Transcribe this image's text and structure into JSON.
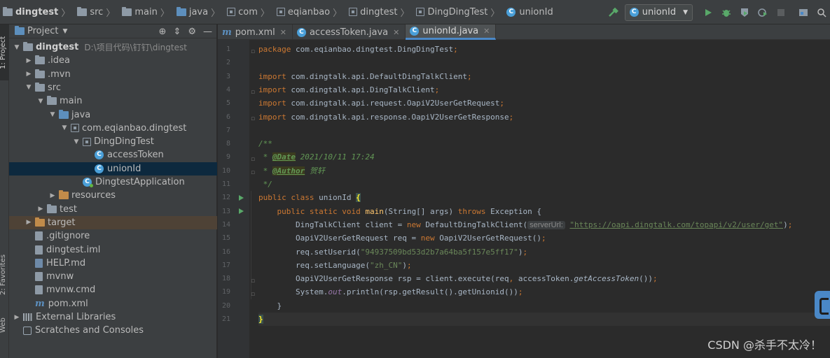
{
  "breadcrumbs": [
    {
      "label": "dingtest",
      "icon": "project-folder-icon",
      "bold": true
    },
    {
      "label": "src",
      "icon": "folder-icon"
    },
    {
      "label": "main",
      "icon": "folder-icon"
    },
    {
      "label": "java",
      "icon": "source-folder-icon"
    },
    {
      "label": "com",
      "icon": "package-icon"
    },
    {
      "label": "eqianbao",
      "icon": "package-icon"
    },
    {
      "label": "dingtest",
      "icon": "package-icon"
    },
    {
      "label": "DingDingTest",
      "icon": "package-icon"
    },
    {
      "label": "unionId",
      "icon": "class-icon"
    }
  ],
  "toolbar": {
    "run_config": "unionId",
    "icons": [
      "build-hammer-icon",
      "run-icon",
      "debug-icon",
      "coverage-icon",
      "profile-icon",
      "stop-icon",
      "project-structure-icon",
      "search-icon"
    ]
  },
  "left_stripe": {
    "tabs": [
      "1: Project",
      "2: Favorites",
      "Web"
    ]
  },
  "project_panel": {
    "title": "Project",
    "tree": [
      {
        "label": "dingtest",
        "path": "D:\\项目代码\\钉钉\\dingtest",
        "depth": 0,
        "arrow": "open",
        "icon": "project-folder-icon",
        "bold": true
      },
      {
        "label": ".idea",
        "depth": 1,
        "arrow": "closed",
        "icon": "folder-icon"
      },
      {
        "label": ".mvn",
        "depth": 1,
        "arrow": "closed",
        "icon": "folder-icon"
      },
      {
        "label": "src",
        "depth": 1,
        "arrow": "open",
        "icon": "folder-icon"
      },
      {
        "label": "main",
        "depth": 2,
        "arrow": "open",
        "icon": "folder-icon"
      },
      {
        "label": "java",
        "depth": 3,
        "arrow": "open",
        "icon": "source-folder-icon"
      },
      {
        "label": "com.eqianbao.dingtest",
        "depth": 4,
        "arrow": "open",
        "icon": "package-icon"
      },
      {
        "label": "DingDingTest",
        "depth": 5,
        "arrow": "open",
        "icon": "package-icon"
      },
      {
        "label": "accessToken",
        "depth": 6,
        "arrow": "none",
        "icon": "class-icon"
      },
      {
        "label": "unionId",
        "depth": 6,
        "arrow": "none",
        "icon": "class-icon",
        "selected": true
      },
      {
        "label": "DingtestApplication",
        "depth": 5,
        "arrow": "none",
        "icon": "spring-class-icon"
      },
      {
        "label": "resources",
        "depth": 3,
        "arrow": "closed",
        "icon": "resources-folder-icon"
      },
      {
        "label": "test",
        "depth": 2,
        "arrow": "closed",
        "icon": "folder-icon"
      },
      {
        "label": "target",
        "depth": 1,
        "arrow": "closed",
        "icon": "excluded-folder-icon",
        "excluded": true
      },
      {
        "label": ".gitignore",
        "depth": 1,
        "arrow": "none",
        "icon": "file-icon"
      },
      {
        "label": "dingtest.iml",
        "depth": 1,
        "arrow": "none",
        "icon": "iml-file-icon"
      },
      {
        "label": "HELP.md",
        "depth": 1,
        "arrow": "none",
        "icon": "markdown-file-icon"
      },
      {
        "label": "mvnw",
        "depth": 1,
        "arrow": "none",
        "icon": "file-icon"
      },
      {
        "label": "mvnw.cmd",
        "depth": 1,
        "arrow": "none",
        "icon": "file-icon"
      },
      {
        "label": "pom.xml",
        "depth": 1,
        "arrow": "none",
        "icon": "maven-icon"
      },
      {
        "label": "External Libraries",
        "depth": 0,
        "arrow": "closed",
        "icon": "libraries-icon"
      },
      {
        "label": "Scratches and Consoles",
        "depth": 0,
        "arrow": "none",
        "icon": "scratches-icon"
      }
    ]
  },
  "editor": {
    "tabs": [
      {
        "label": "pom.xml",
        "icon": "maven-icon",
        "active": false
      },
      {
        "label": "accessToken.java",
        "icon": "class-icon",
        "active": false
      },
      {
        "label": "unionId.java",
        "icon": "class-icon",
        "active": true
      }
    ],
    "current_line": 21,
    "run_gutter_lines": [
      12,
      13
    ],
    "lines": [
      [
        {
          "t": "package ",
          "c": "kw"
        },
        {
          "t": "com.eqianbao.dingtest.DingDingTest",
          "c": ""
        },
        {
          "t": ";",
          "c": "kw"
        }
      ],
      [],
      [
        {
          "t": "import ",
          "c": "kw"
        },
        {
          "t": "com.dingtalk.api.DefaultDingTalkClient",
          "c": ""
        },
        {
          "t": ";",
          "c": "kw"
        }
      ],
      [
        {
          "t": "import ",
          "c": "kw"
        },
        {
          "t": "com.dingtalk.api.DingTalkClient",
          "c": ""
        },
        {
          "t": ";",
          "c": "kw"
        }
      ],
      [
        {
          "t": "import ",
          "c": "kw"
        },
        {
          "t": "com.dingtalk.api.request.OapiV2UserGetRequest",
          "c": ""
        },
        {
          "t": ";",
          "c": "kw"
        }
      ],
      [
        {
          "t": "import ",
          "c": "kw"
        },
        {
          "t": "com.dingtalk.api.response.OapiV2UserGetResponse",
          "c": ""
        },
        {
          "t": ";",
          "c": "kw"
        }
      ],
      [],
      [
        {
          "t": "/**",
          "c": "cm"
        }
      ],
      [
        {
          "t": " * ",
          "c": "cm"
        },
        {
          "t": "@Date",
          "c": "tag"
        },
        {
          "t": " 2021/10/11 17:24",
          "c": "cm"
        }
      ],
      [
        {
          "t": " * ",
          "c": "cm"
        },
        {
          "t": "@Author",
          "c": "tag"
        },
        {
          "t": " 贺轩",
          "c": "cm"
        }
      ],
      [
        {
          "t": " */",
          "c": "cm"
        }
      ],
      [
        {
          "t": "public class ",
          "c": "kw"
        },
        {
          "t": "unionId ",
          "c": ""
        },
        {
          "t": "{",
          "c": "brace-hl"
        }
      ],
      [
        {
          "t": "    public static void ",
          "c": "kw"
        },
        {
          "t": "main",
          "c": "fn"
        },
        {
          "t": "(String[] args) ",
          "c": ""
        },
        {
          "t": "throws ",
          "c": "kw"
        },
        {
          "t": "Exception {",
          "c": ""
        }
      ],
      [
        {
          "t": "        DingTalkClient client = ",
          "c": ""
        },
        {
          "t": "new ",
          "c": "kw"
        },
        {
          "t": "DefaultDingTalkClient(",
          "c": ""
        },
        {
          "t": "serverUrl:",
          "c": "hint"
        },
        {
          "t": " ",
          "c": ""
        },
        {
          "t": "\"https://oapi.dingtalk.com/topapi/v2/user/get\"",
          "c": "url"
        },
        {
          "t": ")",
          "c": ""
        },
        {
          "t": ";",
          "c": "kw"
        }
      ],
      [
        {
          "t": "        OapiV2UserGetRequest req = ",
          "c": ""
        },
        {
          "t": "new ",
          "c": "kw"
        },
        {
          "t": "OapiV2UserGetRequest()",
          "c": ""
        },
        {
          "t": ";",
          "c": "kw"
        }
      ],
      [
        {
          "t": "        req.setUserid(",
          "c": ""
        },
        {
          "t": "\"94937509bd53d2b7a64ba5f157e5ff17\"",
          "c": "str"
        },
        {
          "t": ")",
          "c": ""
        },
        {
          "t": ";",
          "c": "kw"
        }
      ],
      [
        {
          "t": "        req.setLanguage(",
          "c": ""
        },
        {
          "t": "\"zh_CN\"",
          "c": "str"
        },
        {
          "t": ")",
          "c": ""
        },
        {
          "t": ";",
          "c": "kw"
        }
      ],
      [
        {
          "t": "        OapiV2UserGetResponse rsp = client.execute(req",
          "c": ""
        },
        {
          "t": ", ",
          "c": "kw"
        },
        {
          "t": "accessToken.",
          "c": ""
        },
        {
          "t": "getAccessToken",
          "c": "it"
        },
        {
          "t": "())",
          "c": ""
        },
        {
          "t": ";",
          "c": "kw"
        }
      ],
      [
        {
          "t": "        System.",
          "c": ""
        },
        {
          "t": "out",
          "c": "fld"
        },
        {
          "t": ".println(rsp.getResult().getUnionid())",
          "c": ""
        },
        {
          "t": ";",
          "c": "kw"
        }
      ],
      [
        {
          "t": "    }",
          "c": ""
        }
      ],
      [
        {
          "t": "}",
          "c": "brace-hl"
        }
      ]
    ]
  },
  "watermark": "CSDN @杀手不太冷！",
  "colors": {
    "keyword": "#cc7832",
    "string": "#6a8759",
    "method": "#ffc66d",
    "comment": "#629755",
    "selection": "#0d293e",
    "excluded": "#4e4236"
  }
}
